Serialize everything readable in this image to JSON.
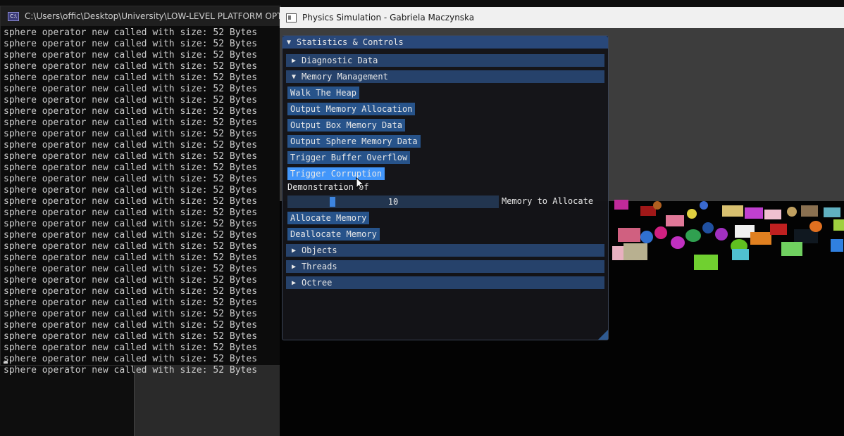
{
  "console": {
    "title": "C:\\Users\\offic\\Desktop\\University\\LOW-LEVEL PLATFORM OPTIMISAT",
    "icon": "console-icon",
    "lines": [
      "sphere operator new called with size: 52 Bytes",
      "sphere operator new called with size: 52 Bytes",
      "sphere operator new called with size: 52 Bytes",
      "sphere operator new called with size: 52 Bytes",
      "sphere operator new called with size: 52 Bytes",
      "sphere operator new called with size: 52 Bytes",
      "sphere operator new called with size: 52 Bytes",
      "sphere operator new called with size: 52 Bytes",
      "sphere operator new called with size: 52 Bytes",
      "sphere operator new called with size: 52 Bytes",
      "sphere operator new called with size: 52 Bytes",
      "sphere operator new called with size: 52 Bytes",
      "sphere operator new called with size: 52 Bytes",
      "sphere operator new called with size: 52 Bytes",
      "sphere operator new called with size: 52 Bytes",
      "sphere operator new called with size: 52 Bytes",
      "sphere operator new called with size: 52 Bytes",
      "sphere operator new called with size: 52 Bytes",
      "sphere operator new called with size: 52 Bytes",
      "sphere operator new called with size: 52 Bytes",
      "sphere operator new called with size: 52 Bytes",
      "sphere operator new called with size: 52 Bytes",
      "sphere operator new called with size: 52 Bytes",
      "sphere operator new called with size: 52 Bytes",
      "sphere operator new called with size: 52 Bytes",
      "sphere operator new called with size: 52 Bytes",
      "sphere operator new called with size: 52 Bytes",
      "sphere operator new called with size: 52 Bytes",
      "sphere operator new called with size: 52 Bytes",
      "sphere operator new called with size: 52 Bytes",
      "sphere operator new called with size: 52 Bytes"
    ]
  },
  "app": {
    "title": "Physics Simulation - Gabriela Maczynska",
    "panel": {
      "title": "Statistics & Controls",
      "headers": {
        "diagnostic": "Diagnostic Data",
        "memory": "Memory Management",
        "objects": "Objects",
        "threads": "Threads",
        "octree": "Octree"
      },
      "buttons": {
        "walk_heap": "Walk The Heap",
        "output_alloc": "Output Memory Allocation",
        "output_box": "Output Box Memory Data",
        "output_sphere": "Output Sphere Memory Data",
        "buffer_overflow": "Trigger Buffer Overflow",
        "corruption": "Trigger Corruption",
        "allocate": "Allocate Memory",
        "deallocate": "Deallocate Memory"
      },
      "demo_label": "Demonstration of",
      "slider": {
        "value": "10",
        "label": "Memory to Allocate"
      }
    },
    "colors": {
      "header": "#26426b",
      "button": "#27538a",
      "button_active": "#4296fa",
      "title_bar": "#29487a"
    }
  }
}
